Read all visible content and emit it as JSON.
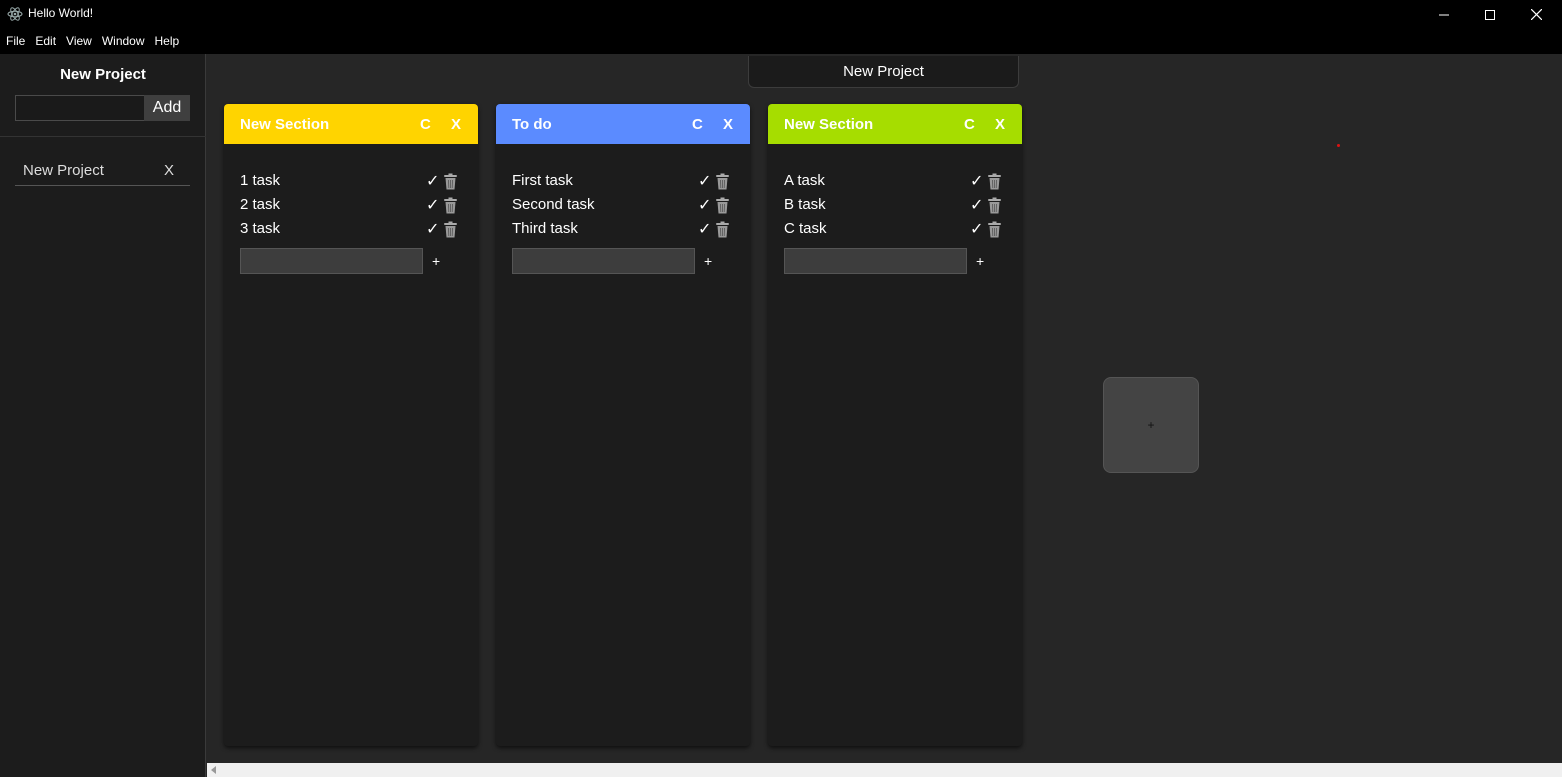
{
  "window": {
    "title": "Hello World!",
    "icon": "electron-atom-icon"
  },
  "menu": [
    "File",
    "Edit",
    "View",
    "Window",
    "Help"
  ],
  "sidebar": {
    "title": "New Project",
    "input_value": "",
    "add_label": "Add",
    "projects": [
      {
        "name": "New Project",
        "remove_label": "X"
      }
    ]
  },
  "main": {
    "project_tab": "New Project",
    "sections": [
      {
        "title": "New Section",
        "color": "#ffd400",
        "color_button": "C",
        "close_button": "X",
        "tasks": [
          "1 task",
          "2 task",
          "3 task"
        ],
        "add_label": "+"
      },
      {
        "title": "To do",
        "color": "#5b8bff",
        "color_button": "C",
        "close_button": "X",
        "tasks": [
          "First task",
          "Second task",
          "Third task"
        ],
        "add_label": "+"
      },
      {
        "title": "New Section",
        "color": "#a6dd00",
        "color_button": "C",
        "close_button": "X",
        "tasks": [
          "A task",
          "B task",
          "C task"
        ],
        "add_label": "+"
      }
    ],
    "add_section_label": "+",
    "task_check_glyph": "✓"
  }
}
